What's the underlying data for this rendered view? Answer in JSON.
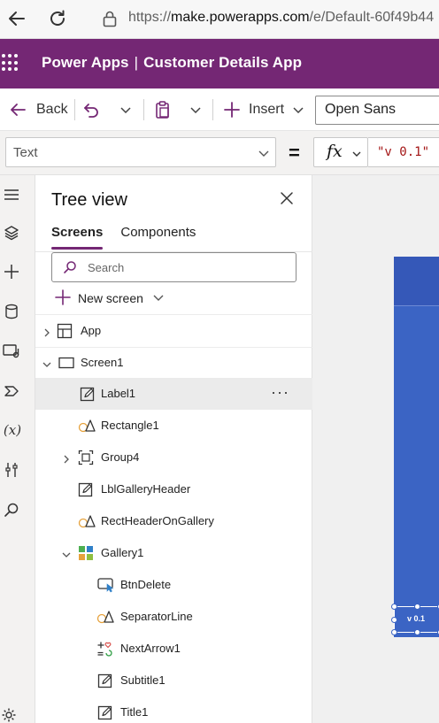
{
  "browser": {
    "url_prefix": "https://",
    "url_host": "make.powerapps.com",
    "url_path": "/e/Default-60f49b44"
  },
  "app_header": {
    "product": "Power Apps",
    "separator": "|",
    "app_name": "Customer Details App",
    "color": "#742774"
  },
  "command_bar": {
    "back_label": "Back",
    "insert_label": "Insert",
    "font_value": "Open Sans"
  },
  "formula_bar": {
    "property": "Text",
    "equals": "=",
    "fx_label": "fx",
    "formula": "\"v 0.1\""
  },
  "left_rail": {
    "icons": [
      "hamburger-icon",
      "layers-icon",
      "plus-icon",
      "database-icon",
      "media-icon",
      "automate-icon",
      "variables-icon",
      "tools-icon",
      "search-icon",
      "settings-icon"
    ]
  },
  "tree_view": {
    "title": "Tree view",
    "tabs": [
      {
        "label": "Screens",
        "active": true
      },
      {
        "label": "Components",
        "active": false
      }
    ],
    "search_placeholder": "Search",
    "new_screen_label": "New screen",
    "items": [
      {
        "label": "App",
        "icon": "app-icon",
        "expandable": "collapsed",
        "level": 0
      },
      {
        "label": "Screen1",
        "icon": "screen-icon",
        "expandable": "expanded",
        "level": 0
      },
      {
        "label": "Label1",
        "icon": "label-icon",
        "expandable": "none",
        "level": 1,
        "selected": true,
        "more": "···"
      },
      {
        "label": "Rectangle1",
        "icon": "shape-icon",
        "expandable": "none",
        "level": 1
      },
      {
        "label": "Group4",
        "icon": "group-icon",
        "expandable": "collapsed",
        "level": 1
      },
      {
        "label": "LblGalleryHeader",
        "icon": "label-icon",
        "expandable": "none",
        "level": 1
      },
      {
        "label": "RectHeaderOnGallery",
        "icon": "shape-icon",
        "expandable": "none",
        "level": 1
      },
      {
        "label": "Gallery1",
        "icon": "gallery-icon",
        "expandable": "expanded",
        "level": 1
      },
      {
        "label": "BtnDelete",
        "icon": "button-icon",
        "expandable": "none",
        "level": 2
      },
      {
        "label": "SeparatorLine",
        "icon": "shape-icon",
        "expandable": "none",
        "level": 2
      },
      {
        "label": "NextArrow1",
        "icon": "icon-control-icon",
        "expandable": "none",
        "level": 2
      },
      {
        "label": "Subtitle1",
        "icon": "label-icon",
        "expandable": "none",
        "level": 2
      },
      {
        "label": "Title1",
        "icon": "label-icon",
        "expandable": "none",
        "level": 2
      }
    ]
  },
  "canvas": {
    "selected_label_text": "v 0.1",
    "screen_color": "#3b64c4"
  }
}
